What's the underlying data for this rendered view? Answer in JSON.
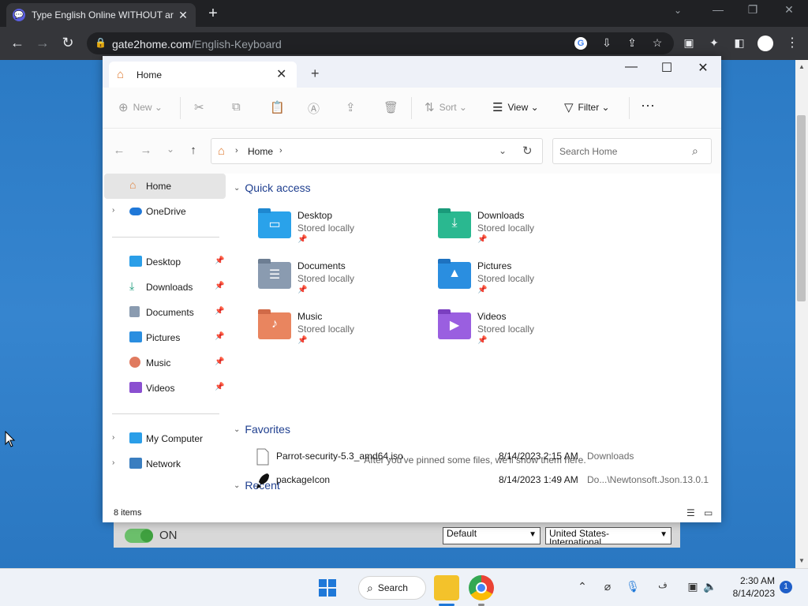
{
  "browser": {
    "tab_title": "Type English Online WITHOUT ar",
    "url_host": "gate2home.com",
    "url_path": "/English-Keyboard"
  },
  "web_panel": {
    "toggle_label": "ON",
    "select1": "Default",
    "select2": "United States-International"
  },
  "explorer": {
    "tab_title": "Home",
    "cmd": {
      "new": "New",
      "sort": "Sort",
      "view": "View",
      "filter": "Filter"
    },
    "address": {
      "crumb": "Home"
    },
    "search_placeholder": "Search Home",
    "nav": {
      "home": "Home",
      "onedrive": "OneDrive",
      "desktop": "Desktop",
      "downloads": "Downloads",
      "documents": "Documents",
      "pictures": "Pictures",
      "music": "Music",
      "videos": "Videos",
      "mycomputer": "My Computer",
      "network": "Network"
    },
    "sections": {
      "quick_access": "Quick access",
      "favorites": "Favorites",
      "recent": "Recent"
    },
    "quick_access": [
      {
        "name": "Desktop",
        "sub": "Stored locally"
      },
      {
        "name": "Downloads",
        "sub": "Stored locally"
      },
      {
        "name": "Documents",
        "sub": "Stored locally"
      },
      {
        "name": "Pictures",
        "sub": "Stored locally"
      },
      {
        "name": "Music",
        "sub": "Stored locally"
      },
      {
        "name": "Videos",
        "sub": "Stored locally"
      }
    ],
    "favorites_empty": "After you've pinned some files, we'll show them here.",
    "recent": [
      {
        "name": "Parrot-security-5.3_amd64.iso",
        "date": "8/14/2023 2:15 AM",
        "location": "Downloads"
      },
      {
        "name": "packageIcon",
        "date": "8/14/2023 1:49 AM",
        "location": "Do...\\Newtonsoft.Json.13.0.1"
      }
    ],
    "status": "8 items"
  },
  "taskbar": {
    "search_label": "Search",
    "time": "2:30 AM",
    "date": "8/14/2023",
    "notif_count": "1"
  },
  "icons": {
    "home": "home-icon",
    "chrome": "chrome-icon",
    "explorer": "file-explorer-icon"
  },
  "colors": {
    "accent": "#1f78d8",
    "section_head": "#1f3f8f"
  }
}
